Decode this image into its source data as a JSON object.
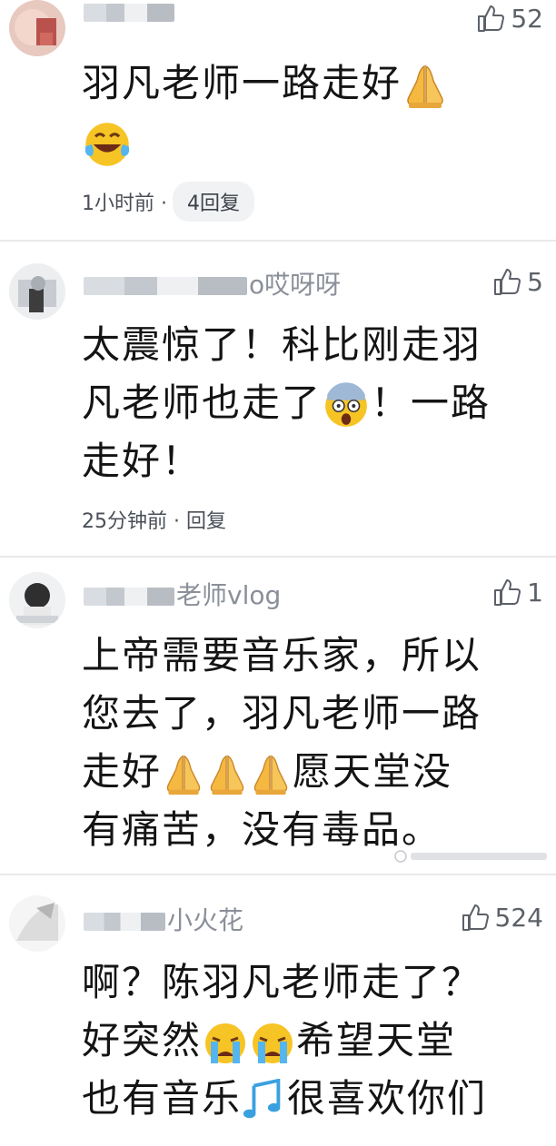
{
  "comments": [
    {
      "username": "",
      "likes": "52",
      "text": "羽凡老师一路走好",
      "time": "1小时前 ·",
      "replies": "4回复"
    },
    {
      "username": "o哎呀呀",
      "likes": "5",
      "text_line1": "太震惊了！科比刚走羽",
      "text_line2a": "凡老师也走了",
      "text_line2b": "！一路",
      "text_line3": "走好！",
      "meta": "25分钟前 · 回复"
    },
    {
      "username": "老师vlog",
      "likes": "1",
      "text_line1": "上帝需要音乐家，所以",
      "text_line2": "您去了，羽凡老师一路",
      "text_line3a": "走好",
      "text_line3b": "愿天堂没",
      "text_line4": "有痛苦，没有毒品。"
    },
    {
      "username": "小火花",
      "likes": "524",
      "text_line1": "啊？陈羽凡老师走了？",
      "text_line2a": "好突然",
      "text_line2b": "希望天堂",
      "text_line3a": "也有音乐",
      "text_line3b": "很喜欢你们"
    }
  ],
  "colors": {
    "text": "#141414",
    "meta": "#4a4f57",
    "username": "#8a8f99",
    "emoji_yellow": "#f7c425",
    "emoji_blue": "#55b5ee"
  },
  "icons": [
    "thumbs-up-icon",
    "pray-emoji",
    "laugh-cry-emoji",
    "shocked-emoji",
    "sob-emoji",
    "music-notes-emoji"
  ]
}
